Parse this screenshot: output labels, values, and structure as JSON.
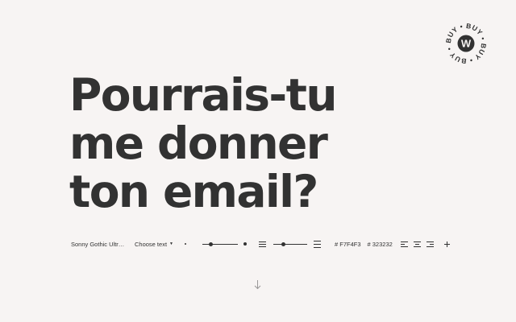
{
  "badge": {
    "ring_text": "BUY • BUY • BUY • BUY •",
    "letter": "W"
  },
  "headline": {
    "lines": [
      "Pourrais-tu",
      "me donner",
      "ton email?"
    ]
  },
  "toolbar": {
    "font_name": "Sonny Gothic Ultra Black",
    "choose_text_label": "Choose text",
    "size_slider_level": 0.25,
    "line_height_slider_level": 0.3,
    "background_color": "# F7F4F3",
    "text_color": "# 323232",
    "icons": [
      "size-small-icon",
      "size-large-icon",
      "line-height-tight-icon",
      "line-height-loose-icon",
      "align-left-icon",
      "align-center-icon",
      "align-right-icon",
      "plus-icon",
      "arrow-down-icon"
    ]
  },
  "colors": {
    "background": "#F7F4F3",
    "text": "#323232"
  }
}
